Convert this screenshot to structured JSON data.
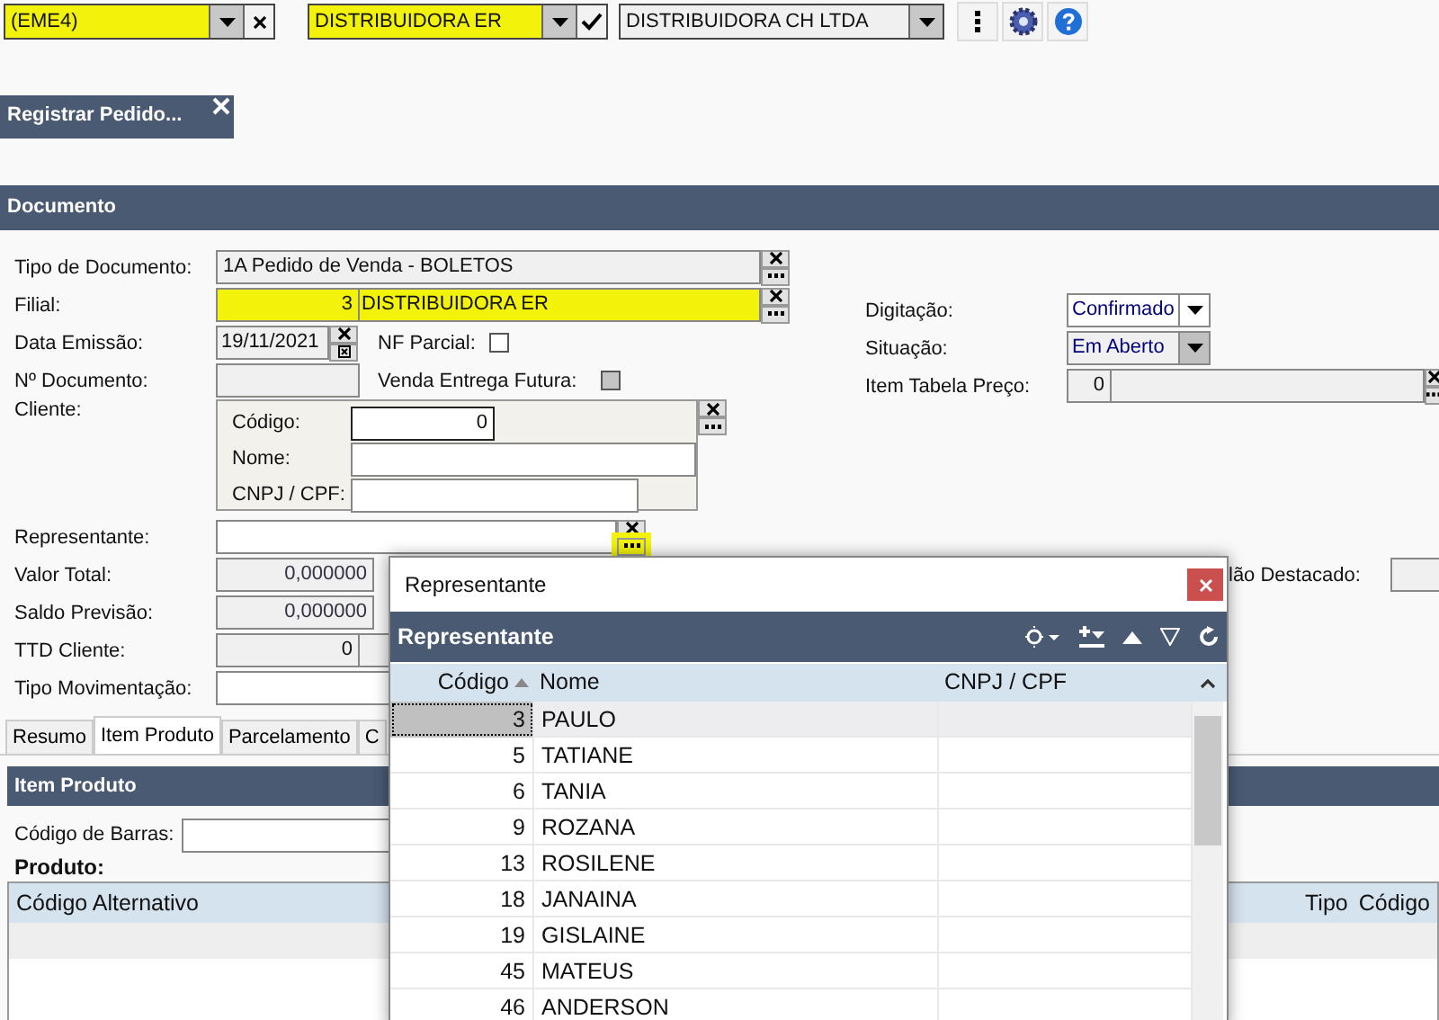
{
  "toolbar": {
    "combos": [
      {
        "value": "(EME4)",
        "highlighted": true,
        "kind": "clear"
      },
      {
        "value": "DISTRIBUIDORA ER",
        "highlighted": true,
        "kind": "confirm"
      },
      {
        "value": "DISTRIBUIDORA CH LTDA",
        "highlighted": false,
        "kind": "plain"
      }
    ]
  },
  "open_tab": {
    "title": "Registrar Pedido..."
  },
  "document": {
    "title": "Documento",
    "tipo_documento": {
      "label": "Tipo de Documento:",
      "value": "1A Pedido de Venda - BOLETOS"
    },
    "filial": {
      "label": "Filial:",
      "code": "3",
      "name": "DISTRIBUIDORA ER"
    },
    "data_emissao": {
      "label": "Data Emissão:",
      "value": "19/11/2021"
    },
    "nf_parcial": {
      "label": "NF Parcial:",
      "disabled": false
    },
    "n_documento": {
      "label": "Nº Documento:"
    },
    "venda_entrega_futura": {
      "label": "Venda Entrega Futura:",
      "disabled": true
    },
    "cliente": {
      "label": "Cliente:",
      "codigo": {
        "label": "Código:",
        "value": "0"
      },
      "nome": {
        "label": "Nome:"
      },
      "cnpj_cpf": {
        "label": "CNPJ / CPF:"
      }
    },
    "representante": {
      "label": "Representante:",
      "search_highlighted": true
    },
    "valor_total": {
      "label": "Valor Total:",
      "value": "0,000000"
    },
    "saldo_previsao": {
      "label": "Saldo Previsão:",
      "value": "0,000000"
    },
    "ttd_cliente": {
      "label": "TTD Cliente:",
      "value": "0"
    },
    "tipo_movimentacao": {
      "label": "Tipo Movimentação:"
    },
    "digitacao": {
      "label": "Digitação:",
      "value": "Confirmado"
    },
    "situacao": {
      "label": "Situação:",
      "value": "Em Aberto"
    },
    "item_tabela_preco": {
      "label": "Item Tabela Preço:",
      "value": "0"
    },
    "destacado": {
      "label": "lão Destacado:"
    }
  },
  "tabs": [
    {
      "label": "Resumo",
      "selected": false
    },
    {
      "label": "Item Produto",
      "selected": true
    },
    {
      "label": "Parcelamento",
      "selected": false
    },
    {
      "label": "C",
      "selected": false
    }
  ],
  "item_produto": {
    "title": "Item Produto",
    "codigo_barras": {
      "label": "Código de Barras:"
    },
    "produto_label": "Produto:",
    "columns": [
      "Código Alternativo",
      "Tipo",
      "Código"
    ]
  },
  "dialog": {
    "title": "Representante",
    "panel_title": "Representante",
    "columns": [
      "Código",
      "Nome",
      "CNPJ / CPF"
    ],
    "rows": [
      {
        "codigo": "3",
        "nome": "PAULO",
        "selected": true
      },
      {
        "codigo": "5",
        "nome": "TATIANE",
        "selected": false
      },
      {
        "codigo": "6",
        "nome": "TANIA",
        "selected": false
      },
      {
        "codigo": "9",
        "nome": "ROZANA",
        "selected": false
      },
      {
        "codigo": "13",
        "nome": "ROSILENE",
        "selected": false
      },
      {
        "codigo": "18",
        "nome": "JANAINA",
        "selected": false
      },
      {
        "codigo": "19",
        "nome": "GISLAINE",
        "selected": false
      },
      {
        "codigo": "45",
        "nome": "MATEUS",
        "selected": false
      },
      {
        "codigo": "46",
        "nome": "ANDERSON",
        "selected": false
      }
    ]
  }
}
